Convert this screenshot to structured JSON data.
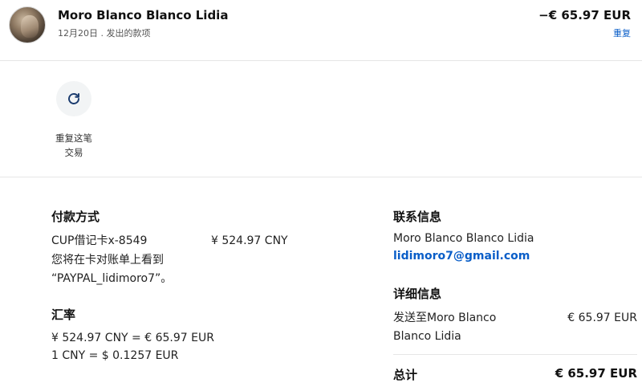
{
  "header": {
    "name": "Moro Blanco Blanco Lidia",
    "subtitle": "12月20日 . 发出的款项",
    "amount": "−€ 65.97 EUR",
    "repeat_link": "重复"
  },
  "action": {
    "repeat_label_line1": "重复这笔",
    "repeat_label_line2": "交易",
    "icon": "refresh-icon"
  },
  "payment": {
    "title": "付款方式",
    "card": "CUP借记卡x-8549",
    "card_amount": "¥ 524.97 CNY",
    "note_line1": "您将在卡对账单上看到",
    "note_line2": "“PAYPAL_lidimoro7”。"
  },
  "exchange": {
    "title": "汇率",
    "line1": "¥ 524.97 CNY = € 65.97 EUR",
    "line2": "1 CNY = $ 0.1257 EUR"
  },
  "contact": {
    "title": "联系信息",
    "name": "Moro Blanco Blanco Lidia",
    "email": "lidimoro7@gmail.com"
  },
  "details": {
    "title": "详细信息",
    "sent_to_line1": "发送至Moro Blanco",
    "sent_to_line2": "Blanco Lidia",
    "sent_amount": "€ 65.97 EUR",
    "total_label": "总计",
    "total_amount": "€ 65.97 EUR"
  },
  "colors": {
    "link": "#0a5ec8",
    "divider": "#e6e6e6"
  }
}
